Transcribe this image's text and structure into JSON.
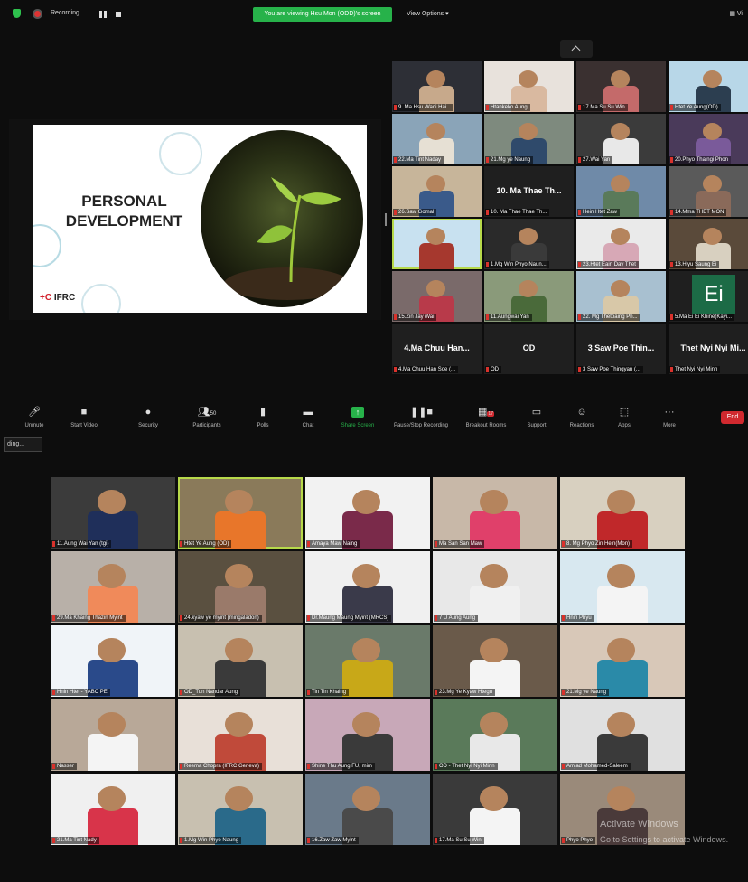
{
  "topbar": {
    "recording_label": "Recording...",
    "viewing_banner": "You are viewing Hsu Mon (ODD)'s screen",
    "view_options": "View Options",
    "view_right": "Vi"
  },
  "slide": {
    "title_line1": "PERSONAL",
    "title_line2": "DEVELOPMENT",
    "logo_text": "IFRC",
    "logo_mark": "+C"
  },
  "top_grid": [
    {
      "name": "9. Ma Hsu Wadi Hai...",
      "bg": "#2d2f36",
      "shirt": "#c7a98b"
    },
    {
      "name": "Htankeko Aung",
      "bg": "#e8e2dc",
      "shirt": "#d9b9a0"
    },
    {
      "name": "17.Ma Su Su Win",
      "bg": "#3a3030",
      "shirt": "#c46a6a"
    },
    {
      "name": "Htet Ye Aung(OD)",
      "bg": "#b8d7e8",
      "shirt": "#2c3e50"
    },
    {
      "name": "22.Ma Tint Naday",
      "bg": "#8aa4b8",
      "shirt": "#e6e0d4"
    },
    {
      "name": "21.Mg ye Naung",
      "bg": "#7e8a7e",
      "shirt": "#2f4a6b"
    },
    {
      "name": "27.Wai Yan",
      "bg": "#3b3b3b",
      "shirt": "#e8e8e8"
    },
    {
      "name": "20.Phyo Thaingi Phon",
      "bg": "#4a3a5a",
      "shirt": "#7a5a9a"
    },
    {
      "name": "26.Saw Gomal",
      "bg": "#c7b59a",
      "shirt": "#3a5a8a"
    },
    {
      "name": "10. Ma Thae Thae Th...",
      "big": "10. Ma Thae Th..."
    },
    {
      "name": "Hein Htet Zaw",
      "bg": "#6f8aa8",
      "shirt": "#5a7a5a"
    },
    {
      "name": "14.Mma THET MON",
      "bg": "#5a5a5a",
      "shirt": "#8a6a5a"
    },
    {
      "name": "",
      "bg": "#c8e1f0",
      "shirt": "#a6382e",
      "active": true
    },
    {
      "name": "1.Mg Win Phyo Naun...",
      "bg": "#2a2a2a",
      "shirt": "#3a3a3a"
    },
    {
      "name": "23.Htet Eain Day Thet",
      "bg": "#eaeaea",
      "shirt": "#d7a8b6"
    },
    {
      "name": "13.Hlyu Saung Ei",
      "bg": "#5a4a3a",
      "shirt": "#d8d0c0"
    },
    {
      "name": "15.Zin Jay Wai",
      "bg": "#7a6a6a",
      "shirt": "#b83a4a"
    },
    {
      "name": "11.Aungwai Yan",
      "bg": "#8a9a7a",
      "shirt": "#4a6a3a"
    },
    {
      "name": "22. Mg Thetpaing Ph...",
      "bg": "#a8c0d0",
      "shirt": "#d8c8a8"
    },
    {
      "name": "5.Ma Ei Ei Khine(Kayi...",
      "ei": "Ei"
    },
    {
      "name": "4.Ma Chuu Han Soe (...",
      "big": "4.Ma Chuu Han..."
    },
    {
      "name": "OD",
      "big": "OD"
    },
    {
      "name": "3 Saw Poe Thingyan (...",
      "big": "3 Saw Poe Thin..."
    },
    {
      "name": "Thet Nyi Nyi Minn",
      "big": "Thet Nyi Nyi Mi..."
    }
  ],
  "toolbar": {
    "unmute": "Unmute",
    "start_video": "Start Video",
    "security": "Security",
    "participants": "Participants",
    "participants_count": "50",
    "polls": "Polls",
    "chat": "Chat",
    "share_screen": "Share Screen",
    "pause_recording": "Pause/Stop Recording",
    "breakout": "Breakout Rooms",
    "breakout_badge": "17",
    "support": "Support",
    "reactions": "Reactions",
    "apps": "Apps",
    "more": "More",
    "end": "End",
    "rec_badge": "ding..."
  },
  "bottom_grid": [
    {
      "name": "11.Aung Wai Yan (tgi)",
      "bg": "#3b3b3b",
      "shirt": "#1f2f5a"
    },
    {
      "name": "Htet Ye Aung (OD)",
      "bg": "#8a7a5a",
      "shirt": "#e8762a",
      "active": true
    },
    {
      "name": "Amaya Maw Naing",
      "bg": "#f2f2f2",
      "shirt": "#7a2a4a"
    },
    {
      "name": "Ma San San Maw",
      "bg": "#c8b8a8",
      "shirt": "#e0406a"
    },
    {
      "name": "8. Mg Phyo Zin Hein(Mon)",
      "bg": "#d8d0c0",
      "shirt": "#c0282a"
    },
    {
      "name": "29.Ma Khaing Thazin Myint",
      "bg": "#b8b0a8",
      "shirt": "#f08a5a"
    },
    {
      "name": "24.kyaw ye myint (mingaladon)",
      "bg": "#5a5040",
      "shirt": "#9a7a6a"
    },
    {
      "name": "Dr.Maung Maung Myint (MRCS)",
      "bg": "#f0f0f0",
      "shirt": "#3a3a4a"
    },
    {
      "name": "7 U Aung Aung",
      "bg": "#e8e8e8",
      "shirt": "#f0f0f0"
    },
    {
      "name": "Hnin Phyu",
      "bg": "#d8e8f0",
      "shirt": "#f4f4f4"
    },
    {
      "name": "Hnin Htet - YABC PE",
      "bg": "#f0f4f8",
      "shirt": "#2a4a8a"
    },
    {
      "name": "OD_Tun Nandar Aung",
      "bg": "#c8c0b0",
      "shirt": "#3a3a3a"
    },
    {
      "name": "Tin Tin Khaing",
      "bg": "#6a7a6a",
      "shirt": "#c8a818"
    },
    {
      "name": "23.Mg Ye Kyaw Htegu",
      "bg": "#6a5a4a",
      "shirt": "#f4f4f4"
    },
    {
      "name": "21.Mg ye Naung",
      "bg": "#d8c8b8",
      "shirt": "#2a8aa8"
    },
    {
      "name": "Nasser",
      "bg": "#b8a898",
      "shirt": "#f4f4f4"
    },
    {
      "name": "Reema Chopra (IFRC Geneva)",
      "bg": "#e8e0d8",
      "shirt": "#c04a3a"
    },
    {
      "name": "Shine Thu Aung FU, mim",
      "bg": "#c8a8b8",
      "shirt": "#3a3a3a"
    },
    {
      "name": "OD - Thet Nyi Nyi Minn",
      "bg": "#5a7a5a",
      "shirt": "#e8e8e8"
    },
    {
      "name": "Amjad Mohamed-Saleem",
      "bg": "#e0e0e0",
      "shirt": "#3a3a3a"
    },
    {
      "name": "21.Ma Tint Nady",
      "bg": "#f0f0f0",
      "shirt": "#d8344a"
    },
    {
      "name": "1.Mg Win Phyo Naung",
      "bg": "#c8c0b0",
      "shirt": "#2a6a8a"
    },
    {
      "name": "16.Zaw Zaw Myint",
      "bg": "#6a7a8a",
      "shirt": "#4a4a4a"
    },
    {
      "name": "17.Ma Su Su Win",
      "bg": "#3a3a3a",
      "shirt": "#f4f4f4"
    },
    {
      "name": "Phyo Phyo",
      "bg": "#9a8a7a",
      "shirt": "#4a3a3a"
    }
  ],
  "watermark": {
    "line1": "Activate Windows",
    "line2": "Go to Settings to activate Windows."
  },
  "colors": {
    "accent_green": "#27b24a",
    "end_red": "#d1292f",
    "active_outline": "#b7d94a"
  }
}
